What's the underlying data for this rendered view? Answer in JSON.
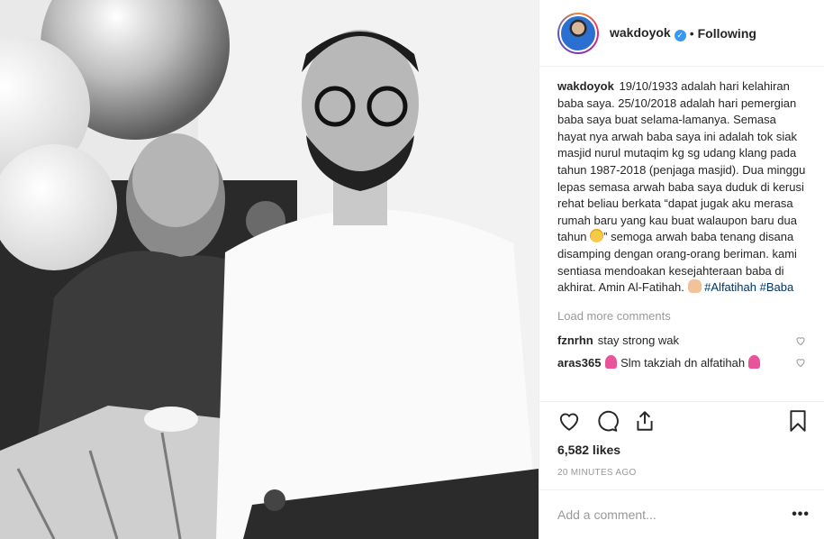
{
  "post": {
    "username": "wakdoyok",
    "follow_status": "Following",
    "separator": "•",
    "verified_icon": "verified-badge-icon"
  },
  "caption": {
    "username": "wakdoyok",
    "text_1": "19/10/1933 adalah hari kelahiran baba saya. 25/10/2018 adalah hari pemergian baba saya buat selama-lamanya. Semasa hayat nya arwah baba saya ini adalah tok siak masjid nurul mutaqim kg sg udang klang pada tahun 1987-2018 (penjaga masjid). Dua minggu lepas semasa arwah baba saya duduk di kerusi rehat beliau berkata “dapat jugak aku merasa rumah baru yang kau buat walaupon baru dua tahun",
    "text_2": "” semoga arwah baba tenang disana disamping dengan orang-orang beriman. kami sentiasa mendoakan kesejahteraan baba di akhirat. Amin Al-Fatihah.",
    "hashtag_1": "#Alfatihah",
    "hashtag_2": "#Baba"
  },
  "load_more": "Load more comments",
  "comments": [
    {
      "user": "fznrhn",
      "text": "stay strong wak"
    },
    {
      "user": "aras365",
      "text": "Slm takziah dn alfatihah"
    }
  ],
  "likes": "6,582 likes",
  "time_ago": "20 MINUTES AGO",
  "add_comment": {
    "placeholder": "Add a comment..."
  },
  "more_options": "•••",
  "colors": {
    "link": "#003569",
    "muted": "#999999",
    "verified": "#3897f0",
    "text": "#262626"
  }
}
